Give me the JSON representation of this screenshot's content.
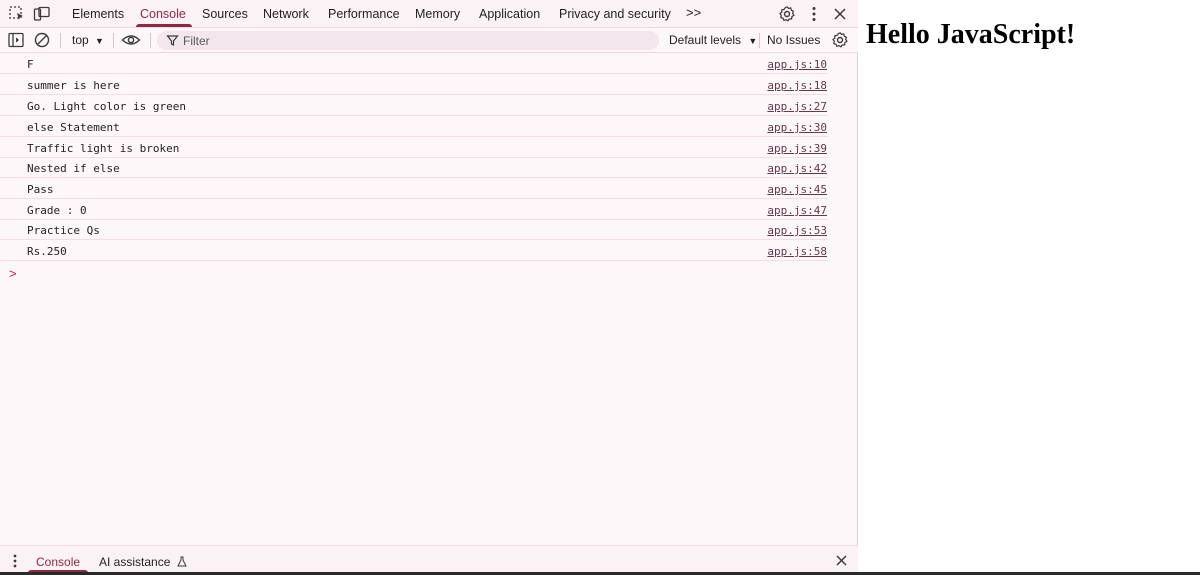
{
  "tabs": [
    "Elements",
    "Console",
    "Sources",
    "Network",
    "Performance",
    "Memory",
    "Application",
    "Privacy and security"
  ],
  "more_tabs_label": ">>",
  "toolbar": {
    "context": "top",
    "filter_placeholder": "Filter",
    "levels": "Default levels",
    "issues": "No Issues"
  },
  "console": [
    {
      "text": "F",
      "source": "app.js:10"
    },
    {
      "text": "summer is here",
      "source": "app.js:18"
    },
    {
      "text": "Go. Light color is green",
      "source": "app.js:27"
    },
    {
      "text": "else Statement",
      "source": "app.js:30"
    },
    {
      "text": "Traffic light is broken",
      "source": "app.js:39"
    },
    {
      "text": "Nested if else",
      "source": "app.js:42"
    },
    {
      "text": "Pass",
      "source": "app.js:45"
    },
    {
      "text": "Grade : 0",
      "source": "app.js:47"
    },
    {
      "text": "Practice Qs",
      "source": "app.js:53"
    },
    {
      "text": "Rs.250",
      "source": "app.js:58"
    }
  ],
  "prompt": ">",
  "drawer": {
    "tab1": "Console",
    "tab2": "AI assistance"
  },
  "page": {
    "heading": "Hello JavaScript!"
  }
}
